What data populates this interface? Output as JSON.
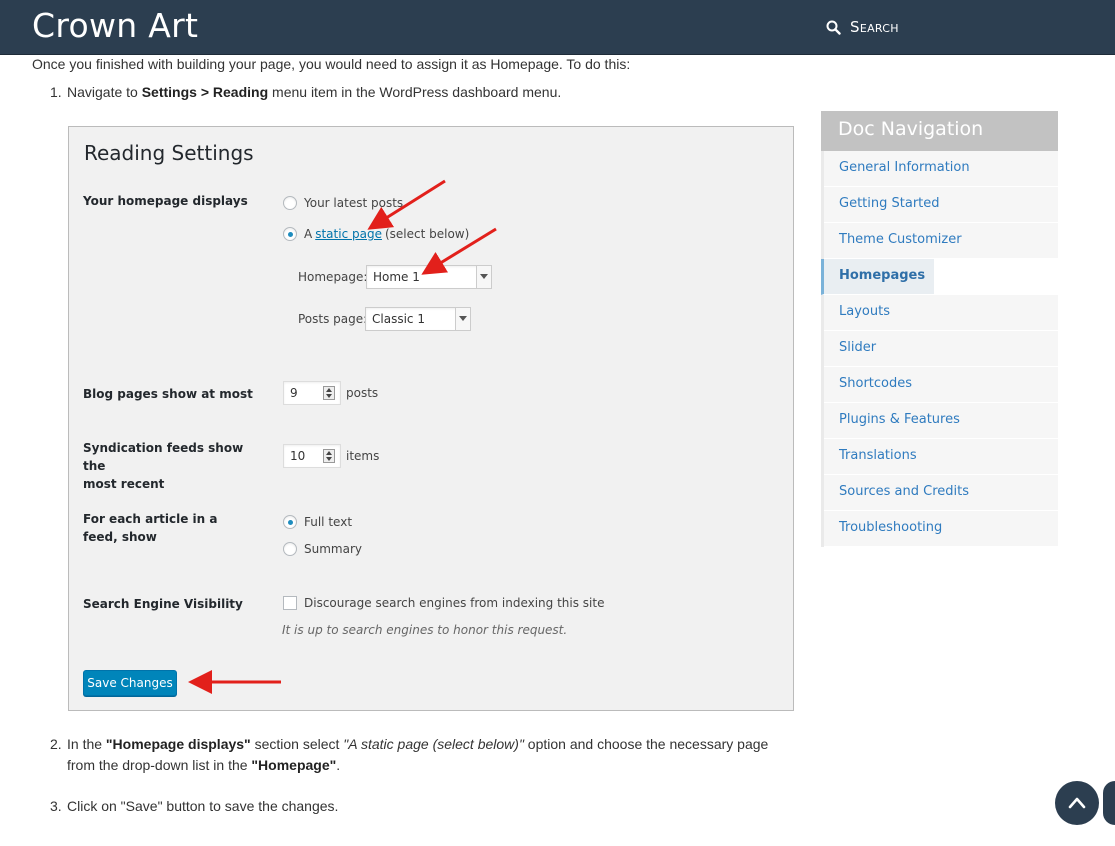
{
  "header": {
    "logo": "Crown Art",
    "search_label": "Search"
  },
  "content": {
    "intro": "Once you finished with building your page, you would need to assign it as Homepage. To do this:",
    "step1": {
      "num": "1.",
      "pre": "Navigate to ",
      "bold": "Settings > Reading",
      "post": " menu item in the WordPress dashboard menu."
    },
    "step2": {
      "num": "2.",
      "pre": "In the ",
      "b1": "\"Homepage displays\"",
      "mid1": " section select ",
      "i1": "\"A static page (select below)\"",
      "mid2": " option and choose the necessary page",
      "line2": "from the drop-down list in the ",
      "b2": "\"Homepage\"",
      "end": "."
    },
    "step3": {
      "num": "3.",
      "text": "Click on \"Save\" button to save the changes."
    }
  },
  "reading_settings": {
    "title": "Reading Settings",
    "homepage_displays": {
      "label": "Your homepage displays",
      "opt_latest": "Your latest posts",
      "opt_static_a": "A",
      "opt_static_link": "static page",
      "opt_static_tail": "(select below)",
      "selected": "static",
      "homepage_label": "Homepage:",
      "homepage_value": "Home 1",
      "posts_page_label": "Posts page:",
      "posts_page_value": "Classic 1"
    },
    "blog_pages": {
      "label": "Blog pages show at most",
      "value": "9",
      "unit": "posts"
    },
    "syndication": {
      "label_line1": "Syndication feeds show the",
      "label_line2": "most recent",
      "value": "10",
      "unit": "items"
    },
    "feed_article": {
      "label": "For each article in a feed, show",
      "opt_full": "Full text",
      "opt_summary": "Summary",
      "selected": "full"
    },
    "search_visibility": {
      "label": "Search Engine Visibility",
      "checkbox_label": "Discourage search engines from indexing this site",
      "checked": false,
      "hint": "It is up to search engines to honor this request."
    },
    "save_button": "Save Changes",
    "arrow_color": "#e2201b"
  },
  "doc_nav": {
    "title": "Doc Navigation",
    "items": [
      {
        "label": "General Information"
      },
      {
        "label": "Getting Started"
      },
      {
        "label": "Theme Customizer"
      },
      {
        "label": "Homepages",
        "active": true
      },
      {
        "label": "Layouts"
      },
      {
        "label": "Slider"
      },
      {
        "label": "Shortcodes"
      },
      {
        "label": "Plugins & Features"
      },
      {
        "label": "Translations"
      },
      {
        "label": "Sources and Credits"
      },
      {
        "label": "Troubleshooting"
      }
    ]
  },
  "colors": {
    "header_bg": "#2c3e50",
    "link": "#2f7bbf",
    "wp_button": "#0085ba"
  }
}
